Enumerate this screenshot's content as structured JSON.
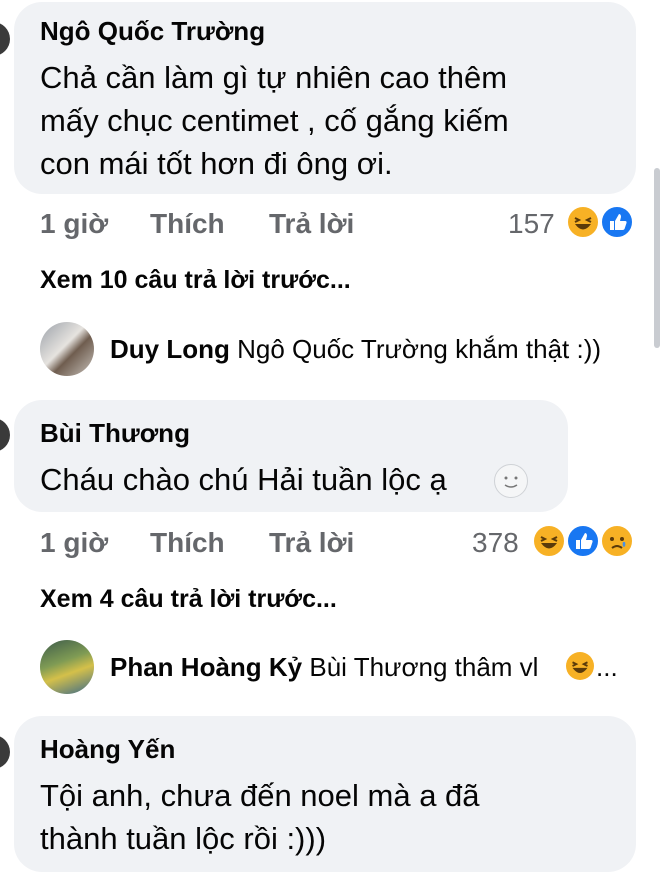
{
  "comments": [
    {
      "author": "Ngô Quốc Trường",
      "text_lines": [
        "Chả cần làm gì tự nhiên cao thêm",
        "mấy chục centimet , cố gắng kiếm",
        "con mái tốt hơn đi ông ơi."
      ],
      "time": "1 giờ",
      "like_label": "Thích",
      "reply_label": "Trả lời",
      "reaction_count": "157",
      "reactions": [
        "haha-icon",
        "like-icon"
      ],
      "view_previous": "Xem 10 câu trả lời trước...",
      "latest_reply": {
        "name": "Duy Long",
        "text": "Ngô Quốc Trường khắm thật :))"
      }
    },
    {
      "author": "Bùi Thương",
      "text_lines": [
        "Cháu chào chú Hải tuần lộc ạ"
      ],
      "time": "1 giờ",
      "like_label": "Thích",
      "reply_label": "Trả lời",
      "reaction_count": "378",
      "reactions": [
        "haha-icon",
        "like-icon",
        "sad-icon"
      ],
      "view_previous": "Xem 4 câu trả lời trước...",
      "latest_reply": {
        "name": "Phan Hoàng Kỷ",
        "text": "Bùi Thương thâm vl",
        "ellipsis": "..."
      }
    },
    {
      "author": "Hoàng Yến",
      "text_lines": [
        "Tội anh, chưa đến noel mà a đã",
        "thành tuần lộc rồi :)))"
      ]
    }
  ],
  "colors": {
    "bubble": "#f0f2f5",
    "meta": "#65676b",
    "like_blue": "#1877f2",
    "haha_yellow": "#f7b125"
  }
}
